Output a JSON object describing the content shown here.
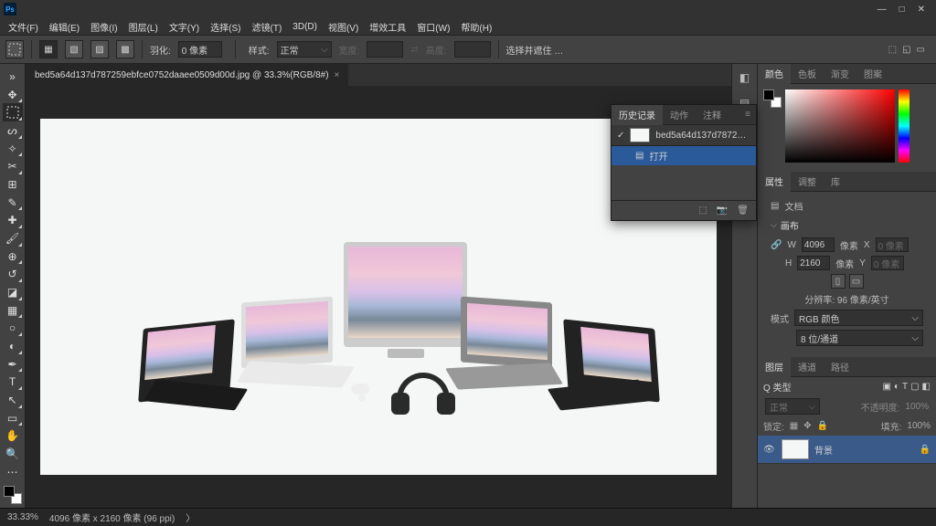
{
  "titlebar": {
    "app": "Ps"
  },
  "menu": [
    "文件(F)",
    "编辑(E)",
    "图像(I)",
    "图层(L)",
    "文字(Y)",
    "选择(S)",
    "滤镜(T)",
    "3D(D)",
    "视图(V)",
    "增效工具",
    "窗口(W)",
    "帮助(H)"
  ],
  "options": {
    "feather_label": "羽化:",
    "feather_value": "0 像素",
    "style_label": "样式:",
    "style_value": "正常",
    "width_label": "宽度:",
    "height_label": "高度:",
    "select_label": "选择并遮住 …"
  },
  "doc_tab": {
    "title": "bed5a64d137d787259ebfce0752daaee0509d00d.jpg @ 33.3%(RGB/8#)"
  },
  "history": {
    "tabs": [
      "历史记录",
      "动作",
      "注释"
    ],
    "source": "bed5a64d137d787259ebfce07...",
    "items": [
      {
        "label": "打开"
      }
    ]
  },
  "color_panel": {
    "tabs": [
      "颜色",
      "色板",
      "渐变",
      "图案"
    ]
  },
  "props": {
    "tabs": [
      "属性",
      "调整",
      "库"
    ],
    "doc_label": "文档",
    "canvas_label": "画布",
    "w_label": "W",
    "w_value": "4096",
    "unit": "像素",
    "x_label": "X",
    "x_value": "0 像素",
    "h_label": "H",
    "h_value": "2160",
    "y_label": "Y",
    "y_value": "0 像素",
    "res_label": "分辨率: 96 像素/英寸",
    "mode_label": "模式",
    "mode_value": "RGB 颜色",
    "depth_value": "8 位/通道"
  },
  "layers": {
    "tabs": [
      "图层",
      "通道",
      "路径"
    ],
    "kind_label": "Q 类型",
    "blend": "正常",
    "opacity_label": "不透明度:",
    "opacity_value": "100%",
    "lock_label": "锁定:",
    "fill_label": "填充:",
    "fill_value": "100%",
    "items": [
      {
        "name": "背景",
        "locked": true
      }
    ]
  },
  "status": {
    "zoom": "33.33%",
    "dims": "4096 像素 x 2160 像素 (96 ppi)"
  },
  "tools": [
    "move",
    "marquee",
    "lasso",
    "wand",
    "crop",
    "frame",
    "eyedropper",
    "heal",
    "brush",
    "stamp",
    "history-brush",
    "eraser",
    "gradient",
    "blur",
    "dodge",
    "pen",
    "type",
    "path-sel",
    "rect",
    "hand",
    "zoom",
    "edit-toolbar"
  ]
}
